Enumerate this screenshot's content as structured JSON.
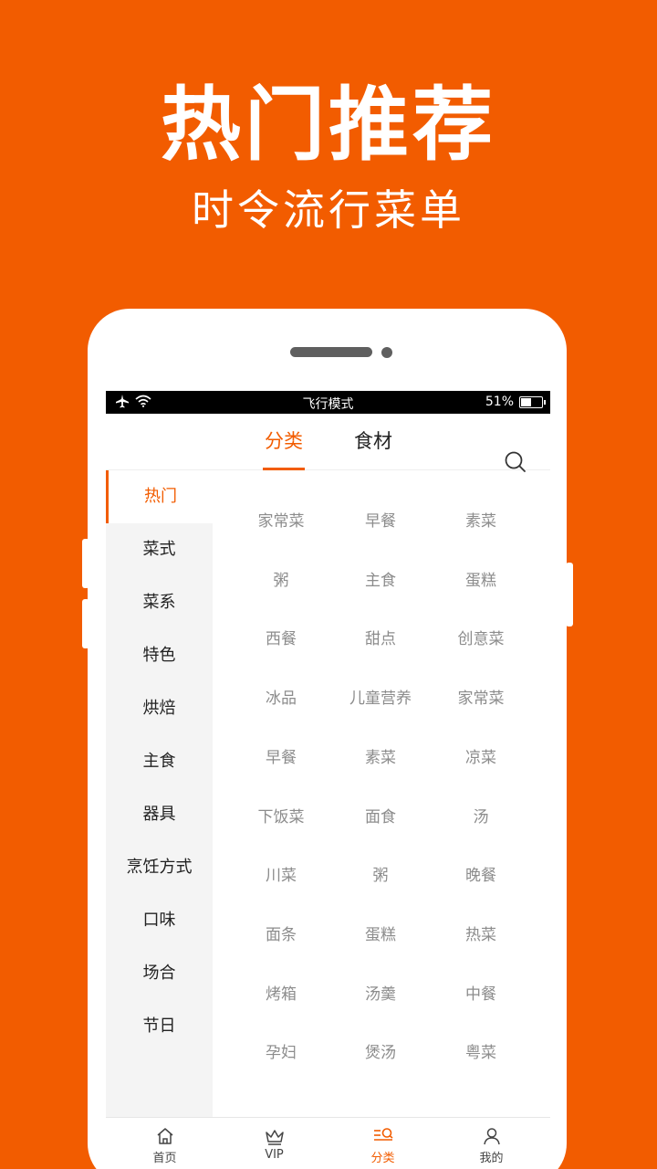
{
  "promo": {
    "title": "热门推荐",
    "subtitle": "时令流行菜单"
  },
  "statusbar": {
    "title": "飞行模式",
    "battery": "51%",
    "battery_level": 0.51,
    "icons": [
      "airplane-icon",
      "wifi-icon"
    ]
  },
  "tabs": {
    "category": "分类",
    "ingredients": "食材",
    "active": "category"
  },
  "sidebar": {
    "items": [
      "热门",
      "菜式",
      "菜系",
      "特色",
      "烘焙",
      "主食",
      "器具",
      "烹饪方式",
      "口味",
      "场合",
      "节日"
    ],
    "active_index": 0
  },
  "grid": {
    "rows": [
      [
        "家常菜",
        "早餐",
        "素菜"
      ],
      [
        "粥",
        "主食",
        "蛋糕"
      ],
      [
        "西餐",
        "甜点",
        "创意菜"
      ],
      [
        "冰品",
        "儿童营养",
        "家常菜"
      ],
      [
        "早餐",
        "素菜",
        "凉菜"
      ],
      [
        "下饭菜",
        "面食",
        "汤"
      ],
      [
        "川菜",
        "粥",
        "晚餐"
      ],
      [
        "面条",
        "蛋糕",
        "热菜"
      ],
      [
        "烤箱",
        "汤羹",
        "中餐"
      ],
      [
        "孕妇",
        "煲汤",
        "粤菜"
      ]
    ]
  },
  "bottomnav": {
    "items": [
      {
        "label": "首页",
        "icon": "home-icon"
      },
      {
        "label": "VIP",
        "icon": "crown-icon"
      },
      {
        "label": "分类",
        "icon": "category-search-icon"
      },
      {
        "label": "我的",
        "icon": "user-icon"
      }
    ],
    "active_index": 2
  },
  "colors": {
    "accent": "#f25c00",
    "text_dark": "#222222",
    "text_muted": "#8c8c8c",
    "sidebar_bg": "#f4f4f4"
  }
}
